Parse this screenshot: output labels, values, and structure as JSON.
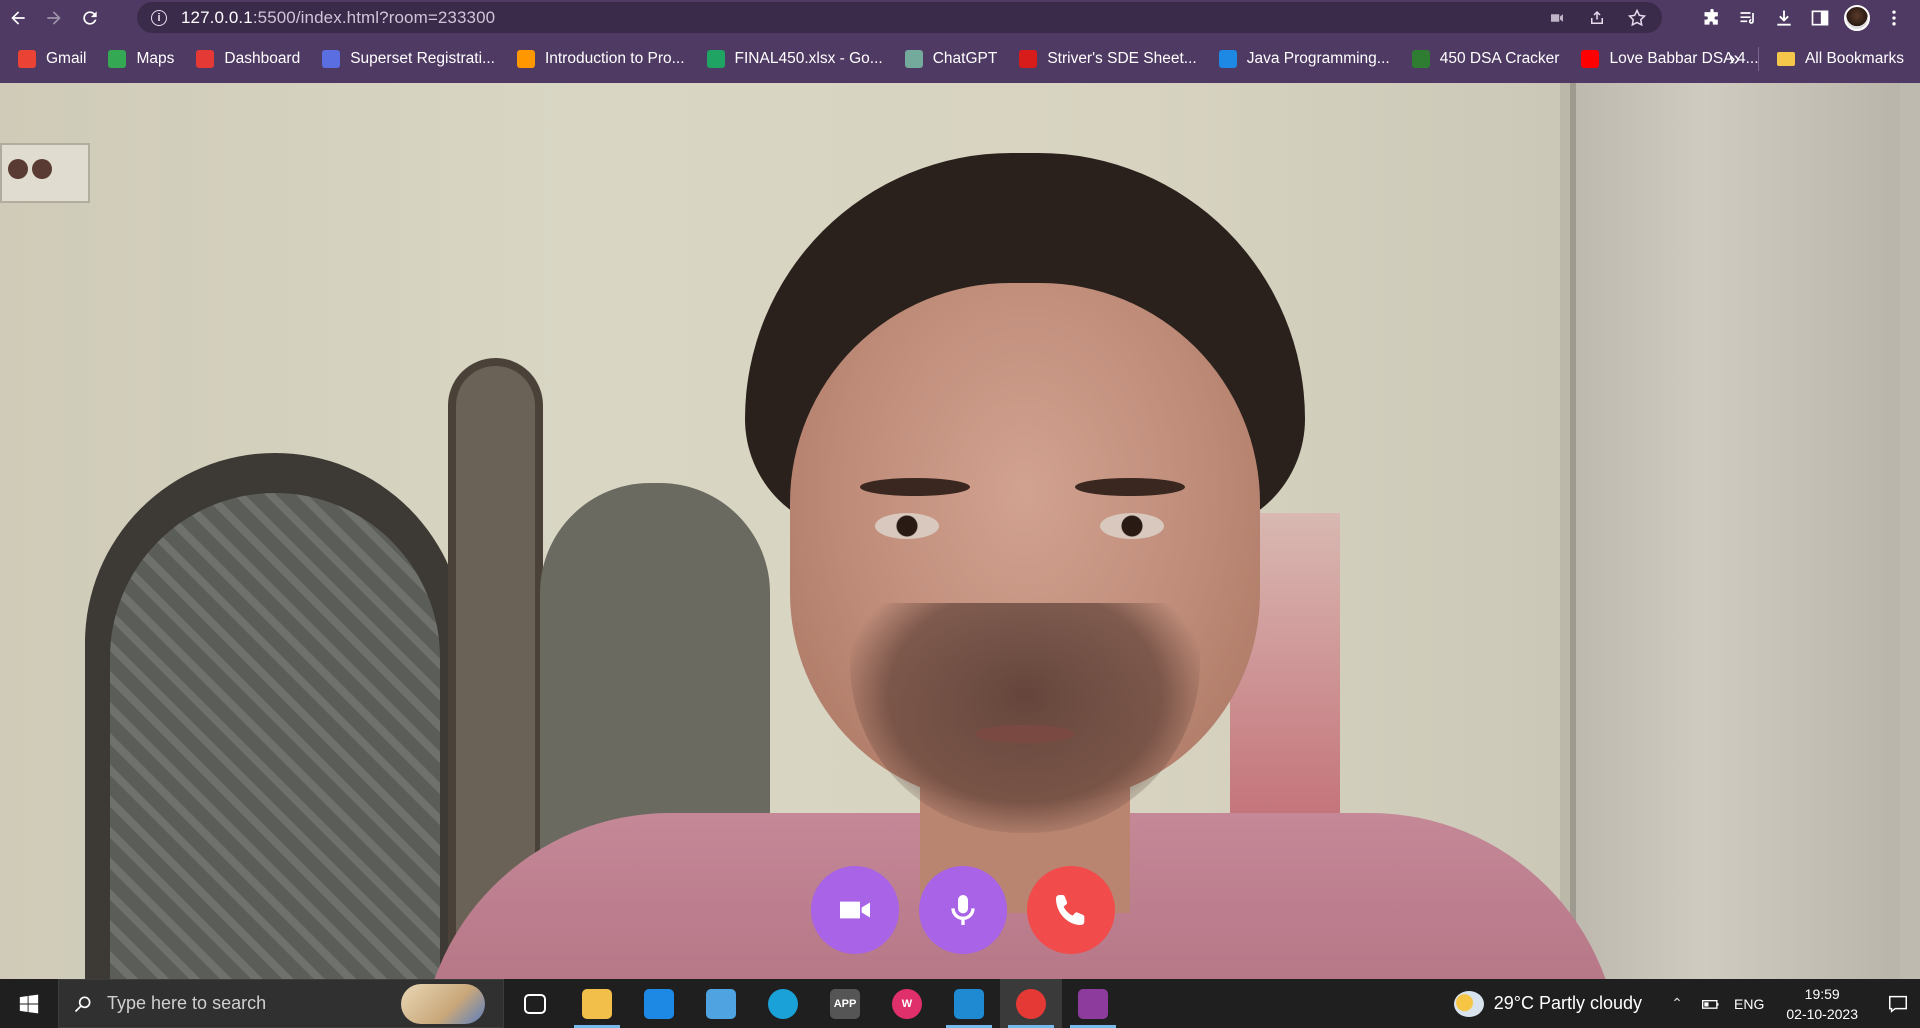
{
  "browser": {
    "url_host": "127.0.0.1",
    "url_path": ":5500/index.html?room=233300"
  },
  "bookmarks": [
    {
      "label": "Gmail",
      "icon": "gmail-icon",
      "color": "#ea4335"
    },
    {
      "label": "Maps",
      "icon": "maps-icon",
      "color": "#34a853"
    },
    {
      "label": "Dashboard",
      "icon": "dashboard-icon",
      "color": "#e53935"
    },
    {
      "label": "Superset Registrati...",
      "icon": "superset-icon",
      "color": "#5b6ee1"
    },
    {
      "label": "Introduction to Pro...",
      "icon": "course-icon",
      "color": "#ff9800"
    },
    {
      "label": "FINAL450.xlsx - Go...",
      "icon": "drive-icon",
      "color": "#1fa463"
    },
    {
      "label": "ChatGPT",
      "icon": "chatgpt-icon",
      "color": "#74aa9c"
    },
    {
      "label": "Striver's SDE Sheet...",
      "icon": "tuf-icon",
      "color": "#d81b1b"
    },
    {
      "label": "Java Programming...",
      "icon": "java-icon",
      "color": "#1e88e5"
    },
    {
      "label": "450 DSA Cracker",
      "icon": "dsa-icon",
      "color": "#2e7d32"
    },
    {
      "label": "Love Babbar DSA 4...",
      "icon": "youtube-icon",
      "color": "#ff0000"
    }
  ],
  "bookmarks_overflow": "»",
  "all_bookmarks": "All Bookmarks",
  "controls": {
    "video_color": "#a863e6",
    "mic_color": "#a863e6",
    "end_color": "#f24b4b"
  },
  "taskbar": {
    "search_placeholder": "Type here to search",
    "apps": [
      {
        "name": "task-view-icon",
        "label": ""
      },
      {
        "name": "file-explorer-icon",
        "label": ""
      },
      {
        "name": "mail-icon",
        "label": ""
      },
      {
        "name": "laptop-icon",
        "label": ""
      },
      {
        "name": "edge-icon",
        "label": ""
      },
      {
        "name": "app-icon",
        "label": "APP"
      },
      {
        "name": "wps-icon",
        "label": "W"
      },
      {
        "name": "vscode-icon",
        "label": ""
      },
      {
        "name": "chrome-icon",
        "label": ""
      },
      {
        "name": "winrar-icon",
        "label": ""
      }
    ],
    "weather": "29°C  Partly cloudy",
    "lang": "ENG",
    "time": "19:59",
    "date": "02-10-2023"
  }
}
